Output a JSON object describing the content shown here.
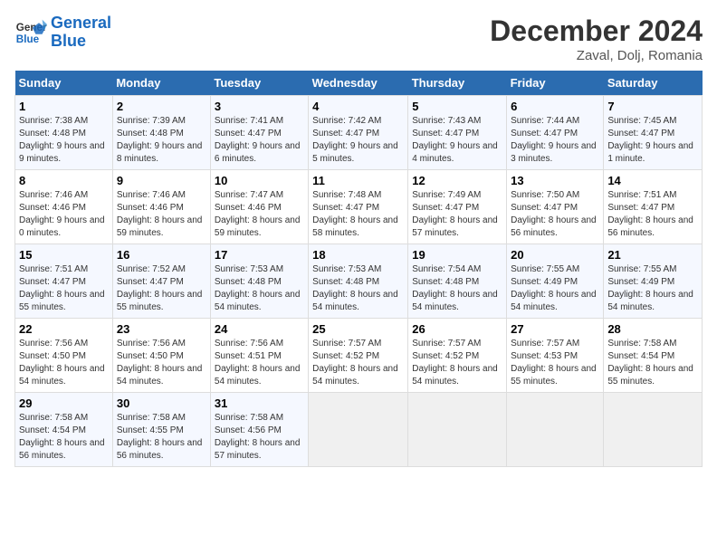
{
  "header": {
    "logo_line1": "General",
    "logo_line2": "Blue",
    "month_title": "December 2024",
    "location": "Zaval, Dolj, Romania"
  },
  "weekdays": [
    "Sunday",
    "Monday",
    "Tuesday",
    "Wednesday",
    "Thursday",
    "Friday",
    "Saturday"
  ],
  "weeks": [
    [
      {
        "day": "1",
        "sunrise": "Sunrise: 7:38 AM",
        "sunset": "Sunset: 4:48 PM",
        "daylight": "Daylight: 9 hours and 9 minutes."
      },
      {
        "day": "2",
        "sunrise": "Sunrise: 7:39 AM",
        "sunset": "Sunset: 4:48 PM",
        "daylight": "Daylight: 9 hours and 8 minutes."
      },
      {
        "day": "3",
        "sunrise": "Sunrise: 7:41 AM",
        "sunset": "Sunset: 4:47 PM",
        "daylight": "Daylight: 9 hours and 6 minutes."
      },
      {
        "day": "4",
        "sunrise": "Sunrise: 7:42 AM",
        "sunset": "Sunset: 4:47 PM",
        "daylight": "Daylight: 9 hours and 5 minutes."
      },
      {
        "day": "5",
        "sunrise": "Sunrise: 7:43 AM",
        "sunset": "Sunset: 4:47 PM",
        "daylight": "Daylight: 9 hours and 4 minutes."
      },
      {
        "day": "6",
        "sunrise": "Sunrise: 7:44 AM",
        "sunset": "Sunset: 4:47 PM",
        "daylight": "Daylight: 9 hours and 3 minutes."
      },
      {
        "day": "7",
        "sunrise": "Sunrise: 7:45 AM",
        "sunset": "Sunset: 4:47 PM",
        "daylight": "Daylight: 9 hours and 1 minute."
      }
    ],
    [
      {
        "day": "8",
        "sunrise": "Sunrise: 7:46 AM",
        "sunset": "Sunset: 4:46 PM",
        "daylight": "Daylight: 9 hours and 0 minutes."
      },
      {
        "day": "9",
        "sunrise": "Sunrise: 7:46 AM",
        "sunset": "Sunset: 4:46 PM",
        "daylight": "Daylight: 8 hours and 59 minutes."
      },
      {
        "day": "10",
        "sunrise": "Sunrise: 7:47 AM",
        "sunset": "Sunset: 4:46 PM",
        "daylight": "Daylight: 8 hours and 59 minutes."
      },
      {
        "day": "11",
        "sunrise": "Sunrise: 7:48 AM",
        "sunset": "Sunset: 4:47 PM",
        "daylight": "Daylight: 8 hours and 58 minutes."
      },
      {
        "day": "12",
        "sunrise": "Sunrise: 7:49 AM",
        "sunset": "Sunset: 4:47 PM",
        "daylight": "Daylight: 8 hours and 57 minutes."
      },
      {
        "day": "13",
        "sunrise": "Sunrise: 7:50 AM",
        "sunset": "Sunset: 4:47 PM",
        "daylight": "Daylight: 8 hours and 56 minutes."
      },
      {
        "day": "14",
        "sunrise": "Sunrise: 7:51 AM",
        "sunset": "Sunset: 4:47 PM",
        "daylight": "Daylight: 8 hours and 56 minutes."
      }
    ],
    [
      {
        "day": "15",
        "sunrise": "Sunrise: 7:51 AM",
        "sunset": "Sunset: 4:47 PM",
        "daylight": "Daylight: 8 hours and 55 minutes."
      },
      {
        "day": "16",
        "sunrise": "Sunrise: 7:52 AM",
        "sunset": "Sunset: 4:47 PM",
        "daylight": "Daylight: 8 hours and 55 minutes."
      },
      {
        "day": "17",
        "sunrise": "Sunrise: 7:53 AM",
        "sunset": "Sunset: 4:48 PM",
        "daylight": "Daylight: 8 hours and 54 minutes."
      },
      {
        "day": "18",
        "sunrise": "Sunrise: 7:53 AM",
        "sunset": "Sunset: 4:48 PM",
        "daylight": "Daylight: 8 hours and 54 minutes."
      },
      {
        "day": "19",
        "sunrise": "Sunrise: 7:54 AM",
        "sunset": "Sunset: 4:48 PM",
        "daylight": "Daylight: 8 hours and 54 minutes."
      },
      {
        "day": "20",
        "sunrise": "Sunrise: 7:55 AM",
        "sunset": "Sunset: 4:49 PM",
        "daylight": "Daylight: 8 hours and 54 minutes."
      },
      {
        "day": "21",
        "sunrise": "Sunrise: 7:55 AM",
        "sunset": "Sunset: 4:49 PM",
        "daylight": "Daylight: 8 hours and 54 minutes."
      }
    ],
    [
      {
        "day": "22",
        "sunrise": "Sunrise: 7:56 AM",
        "sunset": "Sunset: 4:50 PM",
        "daylight": "Daylight: 8 hours and 54 minutes."
      },
      {
        "day": "23",
        "sunrise": "Sunrise: 7:56 AM",
        "sunset": "Sunset: 4:50 PM",
        "daylight": "Daylight: 8 hours and 54 minutes."
      },
      {
        "day": "24",
        "sunrise": "Sunrise: 7:56 AM",
        "sunset": "Sunset: 4:51 PM",
        "daylight": "Daylight: 8 hours and 54 minutes."
      },
      {
        "day": "25",
        "sunrise": "Sunrise: 7:57 AM",
        "sunset": "Sunset: 4:52 PM",
        "daylight": "Daylight: 8 hours and 54 minutes."
      },
      {
        "day": "26",
        "sunrise": "Sunrise: 7:57 AM",
        "sunset": "Sunset: 4:52 PM",
        "daylight": "Daylight: 8 hours and 54 minutes."
      },
      {
        "day": "27",
        "sunrise": "Sunrise: 7:57 AM",
        "sunset": "Sunset: 4:53 PM",
        "daylight": "Daylight: 8 hours and 55 minutes."
      },
      {
        "day": "28",
        "sunrise": "Sunrise: 7:58 AM",
        "sunset": "Sunset: 4:54 PM",
        "daylight": "Daylight: 8 hours and 55 minutes."
      }
    ],
    [
      {
        "day": "29",
        "sunrise": "Sunrise: 7:58 AM",
        "sunset": "Sunset: 4:54 PM",
        "daylight": "Daylight: 8 hours and 56 minutes."
      },
      {
        "day": "30",
        "sunrise": "Sunrise: 7:58 AM",
        "sunset": "Sunset: 4:55 PM",
        "daylight": "Daylight: 8 hours and 56 minutes."
      },
      {
        "day": "31",
        "sunrise": "Sunrise: 7:58 AM",
        "sunset": "Sunset: 4:56 PM",
        "daylight": "Daylight: 8 hours and 57 minutes."
      },
      null,
      null,
      null,
      null
    ]
  ]
}
